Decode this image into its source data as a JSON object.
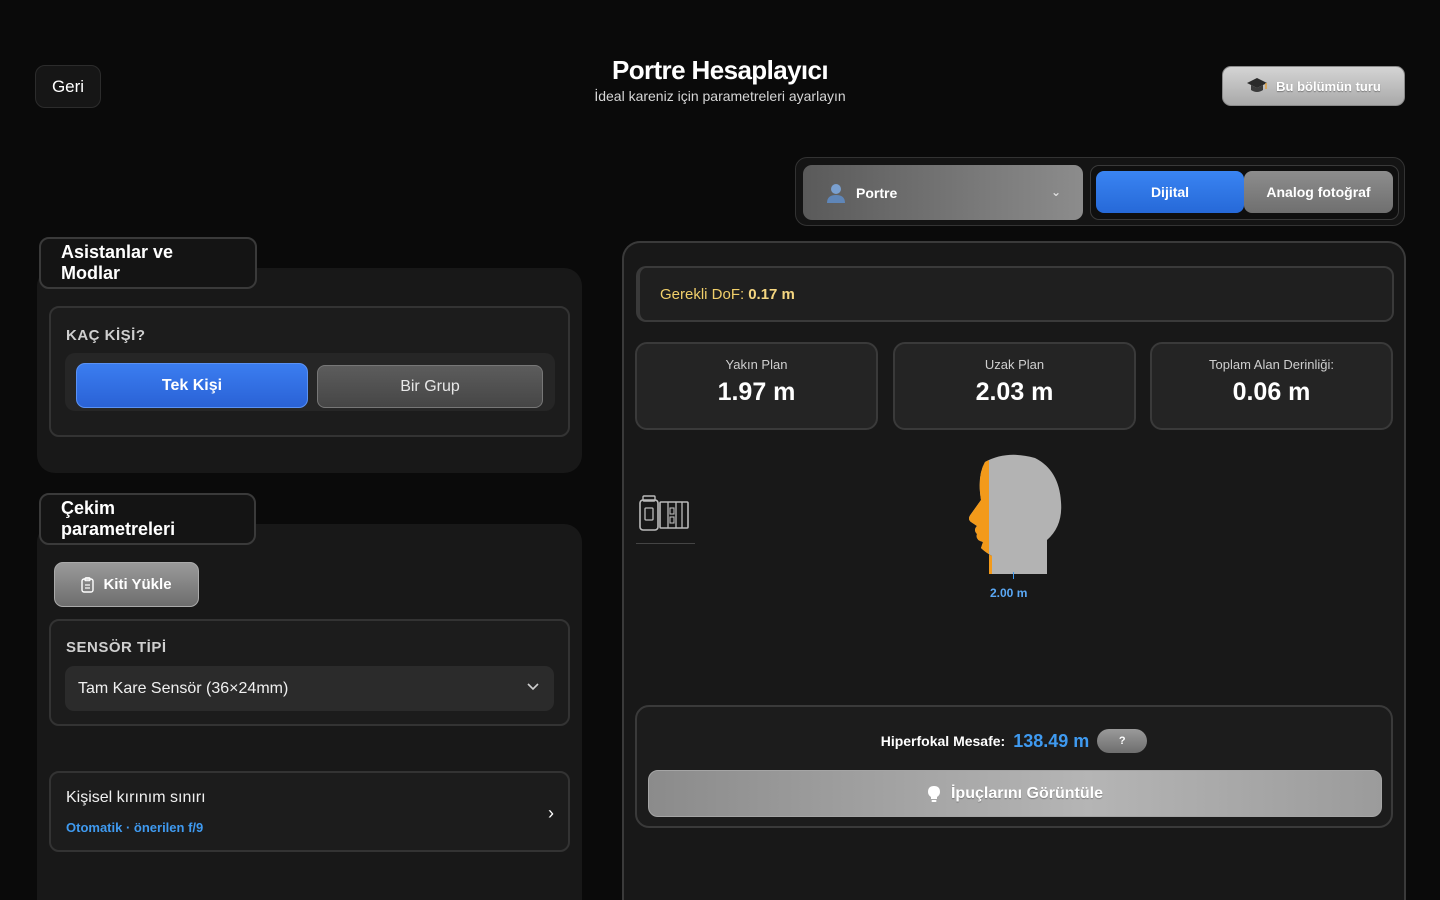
{
  "header": {
    "back_label": "Geri",
    "title": "Portre Hesaplayıcı",
    "subtitle": "İdeal kareniz için parametreleri ayarlayın",
    "tour_label": "Bu bölümün turu"
  },
  "mode_bar": {
    "scene": "Portre",
    "type_options": [
      "Dijital",
      "Analog fotoğraf"
    ],
    "selected_type": "Dijital"
  },
  "assistants": {
    "section_title": "Asistanlar ve Modlar",
    "persons_label": "KAÇ KİŞİ?",
    "persons_options": [
      "Tek Kişi",
      "Bir Grup"
    ],
    "selected_persons": "Tek Kişi"
  },
  "shooting": {
    "section_title": "Çekim parametreleri",
    "kit_button": "Kiti Yükle",
    "sensor_label": "SENSÖR TİPİ",
    "sensor_value": "Tam Kare Sensör (36×24mm)",
    "diffraction_title": "Kişisel kırınım sınırı",
    "diffraction_value": "Otomatik · önerilen f/9"
  },
  "results": {
    "dof_label": "Gerekli DoF:",
    "dof_value": "0.17 m",
    "stats": [
      {
        "label": "Yakın Plan",
        "value": "1.97 m"
      },
      {
        "label": "Uzak Plan",
        "value": "2.03 m"
      },
      {
        "label": "Toplam Alan Derinliği:",
        "value": "0.06 m"
      }
    ],
    "focus_distance": "2.00 m",
    "hyperfocal_label": "Hiperfokal Mesafe:",
    "hyperfocal_value": "138.49 m",
    "help_label": "?",
    "tips_button": "İpuçlarını Görüntüle"
  },
  "colors": {
    "accent_blue": "#3f9af0",
    "dof_yellow": "#f1cf6a",
    "subject_orange": "#f39a1a"
  }
}
